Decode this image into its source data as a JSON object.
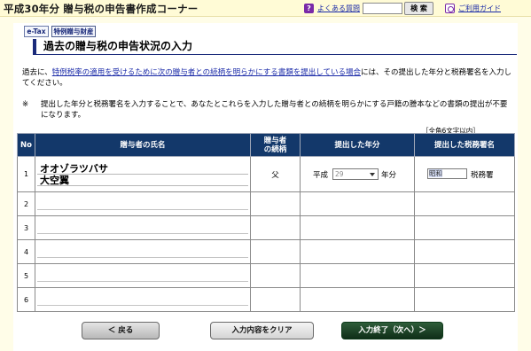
{
  "header": {
    "title": "平成30年分 贈与税の申告書作成コーナー",
    "faq_label": "よくある質問",
    "search_value": "",
    "search_button": "検 索",
    "guide_label": "ご利用ガイド"
  },
  "chips": [
    "e-Tax",
    "特例贈与財産"
  ],
  "section_title": "過去の贈与税の申告状況の入力",
  "lead": {
    "prefix": "過去に、",
    "link": "特例税率の適用を受けるために次の贈与者との続柄を明らかにする書類を提出している場合",
    "suffix": "には、その提出した年分と税務署名を入力してください。"
  },
  "note": {
    "mark": "※",
    "text": "提出した年分と税務署名を入力することで、あなたとこれらを入力した贈与者との続柄を明らかにする戸籍の謄本などの書類の提出が不要になります。"
  },
  "char_limit": "［全角6文字以内］",
  "table": {
    "headers": {
      "no": "No",
      "donor_name": "贈与者の氏名",
      "relation_1": "贈与者",
      "relation_2": "の続柄",
      "year": "提出した年分",
      "office": "提出した税務署名"
    },
    "rows": [
      {
        "no": "1",
        "name_kana": "オオゾラツバサ",
        "name_kanji": "大空翼",
        "relation": "父",
        "era": "平成",
        "year": "29",
        "year_unit": "年分",
        "office": "昭和",
        "office_suffix": "税務署"
      },
      {
        "no": "2"
      },
      {
        "no": "3"
      },
      {
        "no": "4"
      },
      {
        "no": "5"
      },
      {
        "no": "6"
      }
    ]
  },
  "buttons": {
    "back": "＜  戻る",
    "clear": "入力内容をクリア",
    "next": "入力終了（次へ）＞"
  }
}
